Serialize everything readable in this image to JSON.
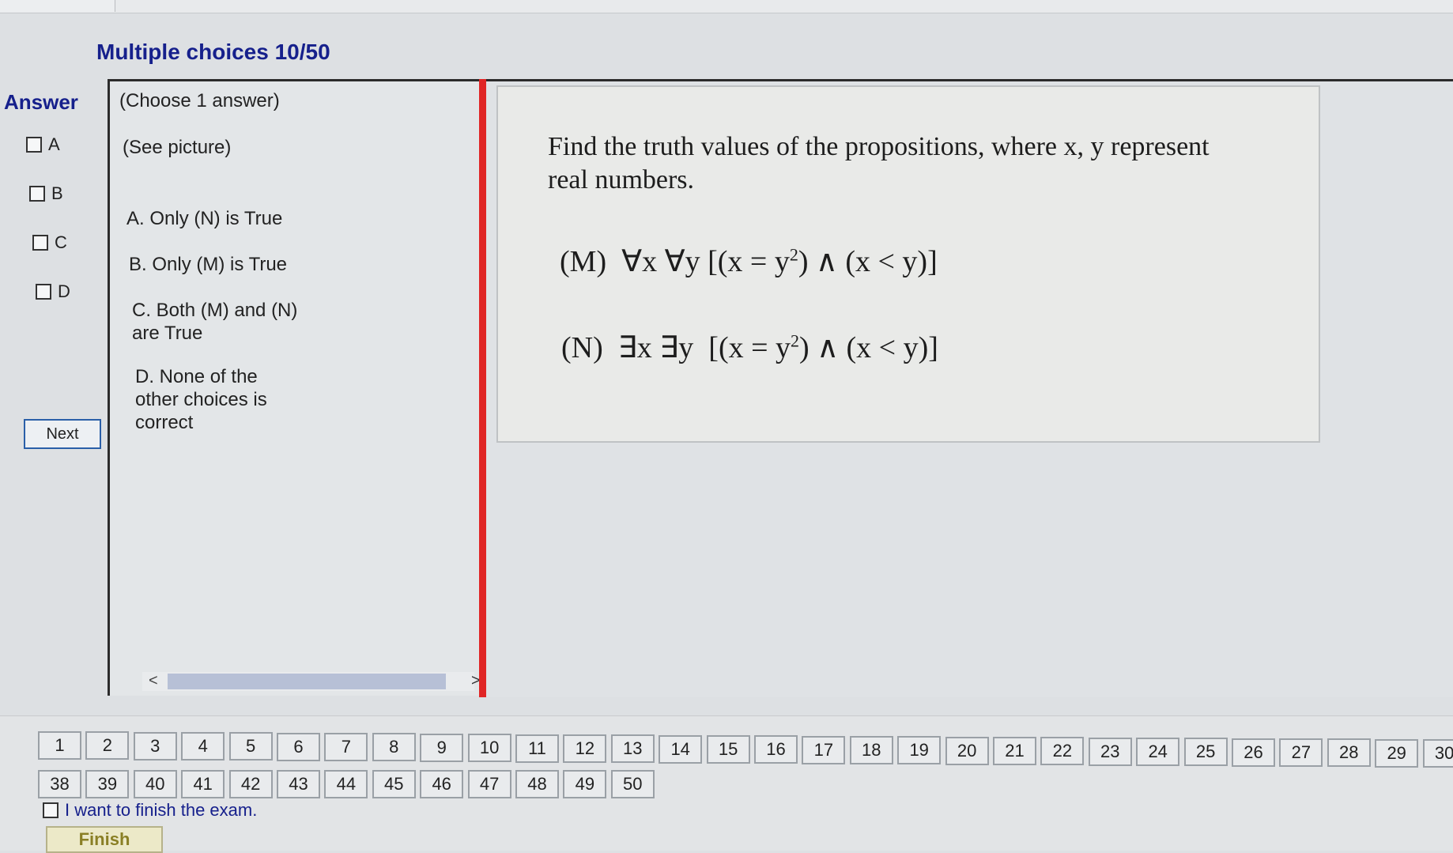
{
  "header": {
    "title": "Multiple choices 10/50"
  },
  "answer_panel": {
    "label": "Answer",
    "options": [
      "A",
      "B",
      "C",
      "D"
    ],
    "next_label": "Next"
  },
  "choices": {
    "instruction": "(Choose 1 answer)",
    "see_picture": "(See picture)",
    "a": "A. Only (N) is True",
    "b": "B. Only (M) is True",
    "c_line1": "C. Both (M) and (N)",
    "c_line2": "are True",
    "d_line1": "D. None of the",
    "d_line2": "other choices is",
    "d_line3": "correct",
    "scroll_left": "<",
    "scroll_right": ">"
  },
  "question": {
    "line1": "Find the truth values of the propositions, where x, y represent",
    "line2": "real numbers.",
    "m": {
      "label": "(M)",
      "quant": "∀x ∀y",
      "body1": "[(x = y",
      "exp": "2",
      "body2": ") ∧ (x < y)]"
    },
    "n": {
      "label": "(N)",
      "quant": "∃x ∃y",
      "body1": "[(x = y",
      "exp": "2",
      "body2": ") ∧ (x < y)]"
    }
  },
  "navigation": {
    "row1": [
      "1",
      "2",
      "3",
      "4",
      "5",
      "6",
      "7",
      "8",
      "9",
      "10",
      "11",
      "12",
      "13",
      "14",
      "15",
      "16",
      "17",
      "18",
      "19",
      "20",
      "21",
      "22",
      "23",
      "24",
      "25",
      "26",
      "27",
      "28",
      "29",
      "30"
    ],
    "row2": [
      "38",
      "39",
      "40",
      "41",
      "42",
      "43",
      "44",
      "45",
      "46",
      "47",
      "48",
      "49",
      "50"
    ]
  },
  "finish": {
    "checkbox_label": "I want to finish the exam.",
    "button_label": "Finish"
  }
}
